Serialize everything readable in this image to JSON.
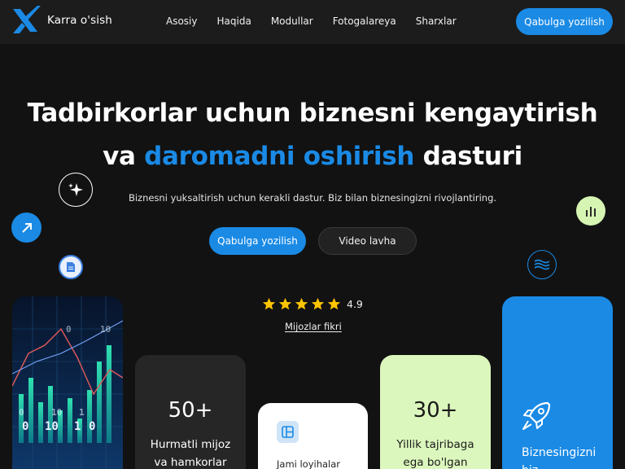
{
  "brand": {
    "name": "Karra o'sish",
    "accent": "#1a8ae5"
  },
  "nav": {
    "items": [
      {
        "label": "Asosiy"
      },
      {
        "label": "Haqida"
      },
      {
        "label": "Modullar"
      },
      {
        "label": "Fotogalareya"
      },
      {
        "label": "Sharxlar"
      }
    ],
    "cta": "Qabulga yozilish"
  },
  "hero": {
    "line1": "Tadbirkorlar uchun biznesni kengaytirish",
    "line2_pre": "va",
    "line2_accent": "daromadni oshirish",
    "line2_post": "dasturi",
    "subtitle": "Biznesni yuksaltirish uchun kerakli dastur. Biz bilan biznesingizni rivojlantiring.",
    "primary_button": "Qabulga yozilish",
    "secondary_button": "Video lavha"
  },
  "rating": {
    "value": "4.9",
    "stars": 5,
    "link": "Mijozlar fikri"
  },
  "cards": {
    "clients": {
      "number": "50+",
      "label_1": "Hurmatli mijoz",
      "label_2": "va hamkorlar"
    },
    "projects": {
      "label": "Jami loyihalar"
    },
    "experience": {
      "number": "30+",
      "label_1": "Yillik tajribaga",
      "label_2": "ega bo'lgan"
    },
    "growth": {
      "label_1": "Biznesingizni",
      "label_2": "biz"
    }
  },
  "icons": [
    "logo-x-icon",
    "sparkle-icon",
    "arrow-up-right-icon",
    "document-icon",
    "bar-chart-icon",
    "wave-icon",
    "star-icon",
    "layout-icon",
    "rocket-icon"
  ]
}
